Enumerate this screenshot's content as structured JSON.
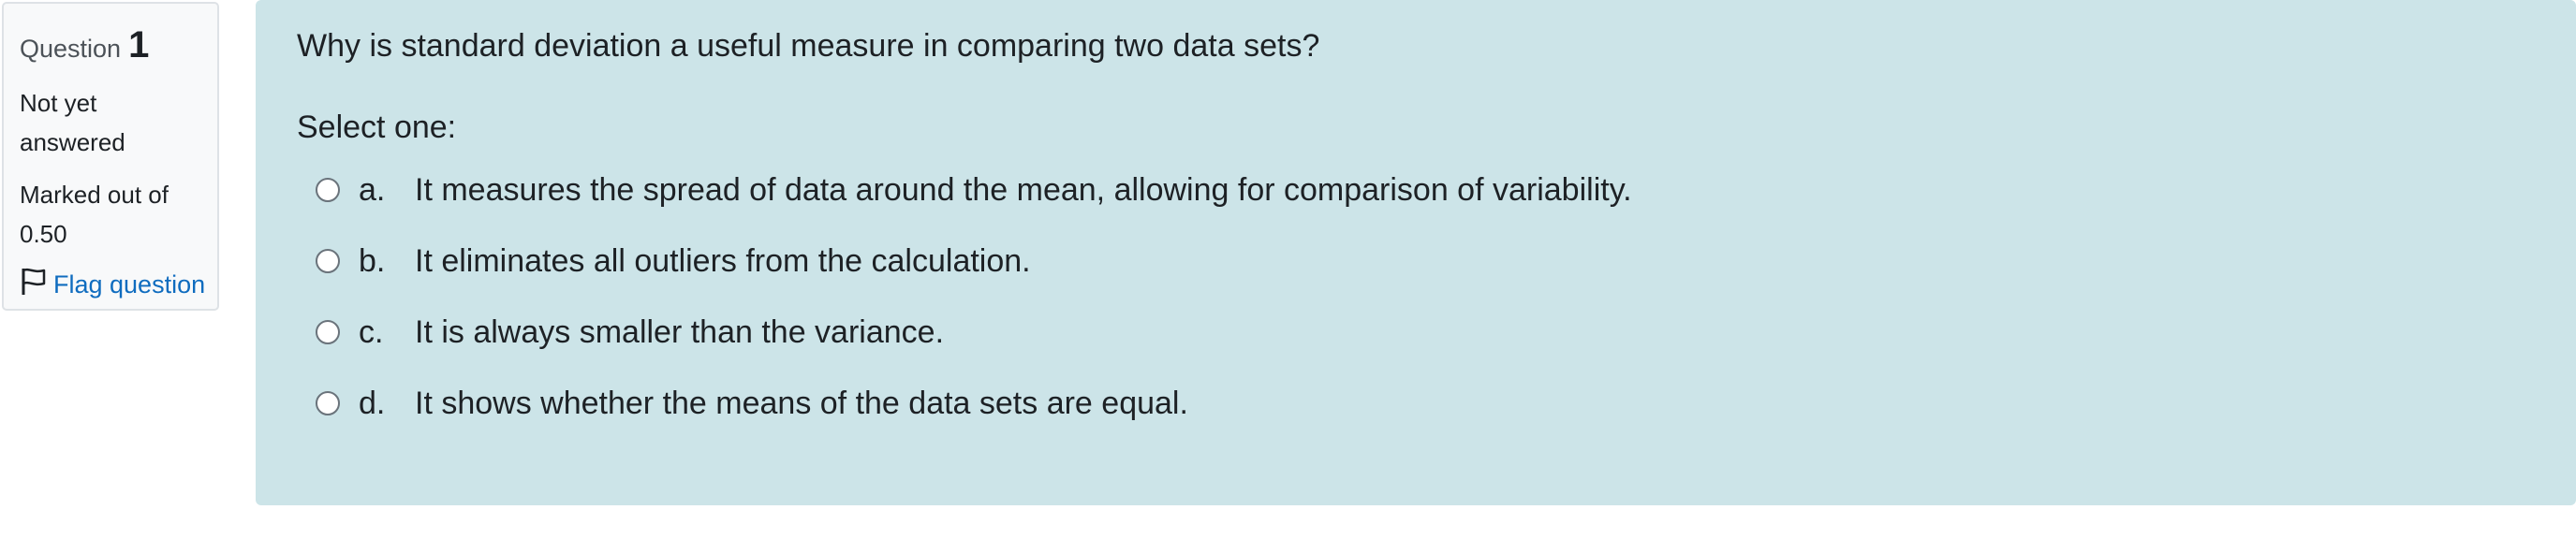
{
  "info": {
    "question_word": "Question",
    "question_number": "1",
    "status": "Not yet answered",
    "marked_out_of": "Marked out of 0.50",
    "flag_label": "Flag question"
  },
  "question": {
    "text": "Why is standard deviation a useful measure in comparing two data sets?",
    "prompt": "Select one:",
    "answers": [
      {
        "letter": "a.",
        "text": "It measures the spread of data around the mean, allowing for comparison of variability."
      },
      {
        "letter": "b.",
        "text": "It eliminates all outliers from the calculation."
      },
      {
        "letter": "c.",
        "text": "It is always smaller than the variance."
      },
      {
        "letter": "d.",
        "text": "It shows whether the means of the data sets are equal."
      }
    ]
  },
  "colors": {
    "content_background": "#cce4e8",
    "info_background": "#f8f9fa",
    "link": "#0f6cbf"
  },
  "icons": {
    "flag": "flag-icon",
    "radio": "radio-icon"
  }
}
